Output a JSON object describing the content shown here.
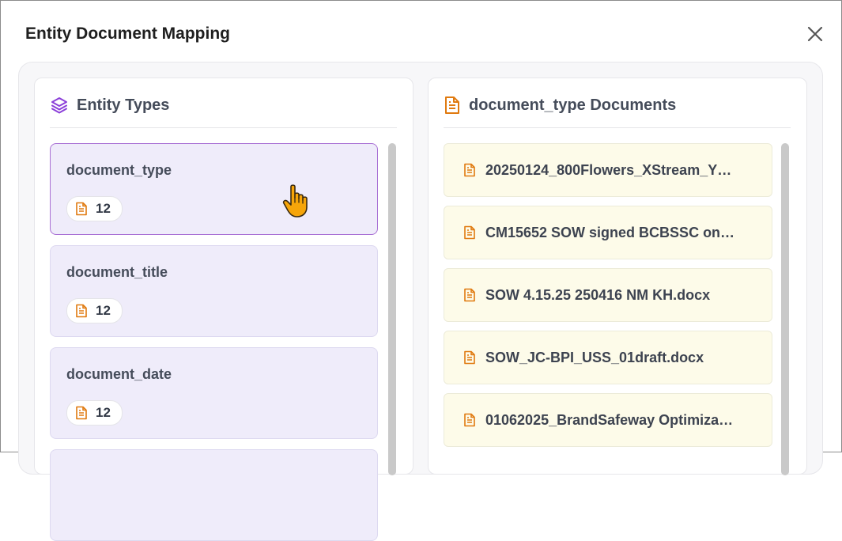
{
  "dialog": {
    "title": "Entity Document Mapping",
    "close_icon": "close-icon"
  },
  "entity_panel": {
    "title": "Entity Types",
    "icon": "layers-icon",
    "items": [
      {
        "name": "document_type",
        "count": "12",
        "selected": true
      },
      {
        "name": "document_title",
        "count": "12",
        "selected": false
      },
      {
        "name": "document_date",
        "count": "12",
        "selected": false
      }
    ]
  },
  "documents_panel": {
    "title": "document_type Documents",
    "icon": "document-icon",
    "items": [
      {
        "name": "20250124_800Flowers_XStream_Y…"
      },
      {
        "name": "CM15652 SOW signed BCBSSC on…"
      },
      {
        "name": "SOW 4.15.25 250416 NM KH.docx"
      },
      {
        "name": "SOW_JC-BPI_USS_01draft.docx"
      },
      {
        "name": "01062025_BrandSafeway Optimiza…"
      }
    ]
  },
  "colors": {
    "entity_accent": "#8b3fd9",
    "document_accent": "#e07a10",
    "selected_border": "#a86fd4",
    "entity_card_bg": "#efecfa",
    "document_card_bg": "#fdfbe9"
  },
  "cursor_icon": "hand-pointer-icon"
}
